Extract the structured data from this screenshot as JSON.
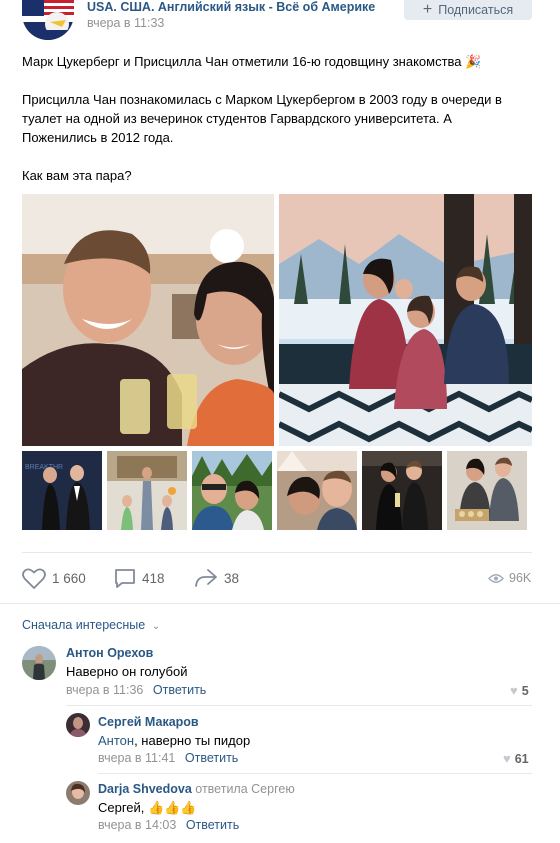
{
  "header": {
    "group_name": "USA. США. Английский язык - Всё об Америке",
    "post_time": "вчера в 11:33",
    "subscribe_label": "Подписаться"
  },
  "post": {
    "headline": "Марк Цукерберг и Присцилла Чан отметили 16-ю годовщину знакомства 🎉",
    "paragraph_line1": "Присцилла Чан познакомилась с Марком Цукербергом в 2003 году в очереди в",
    "paragraph_line2": "туалет на одной из вечеринок студентов Гарвардского университета. А",
    "paragraph_line3": "Поженились в 2012 года.",
    "question": "Как вам эта пара?"
  },
  "actions": {
    "likes": "1 660",
    "comments": "418",
    "shares": "38",
    "views": "96K"
  },
  "comments_sort": "Сначала интересные",
  "comments": [
    {
      "author": "Антон Орехов",
      "text": "Наверно он голубой",
      "time": "вчера в 11:36",
      "reply": "Ответить",
      "likes": "5"
    },
    {
      "author": "Сергей Макаров",
      "mention": "Антон",
      "text": ", наверно ты пидор",
      "time": "вчера в 11:41",
      "reply": "Ответить",
      "likes": "61"
    },
    {
      "author": "Darja Shvedova",
      "replied_to": "ответила Сергею",
      "mention": "Сергей",
      "text": ", 👍👍👍",
      "time": "вчера в 14:03",
      "reply": "Ответить"
    }
  ],
  "colors": {
    "link": "#2a5885",
    "muted": "#939393",
    "separator": "#e7e8ec"
  }
}
